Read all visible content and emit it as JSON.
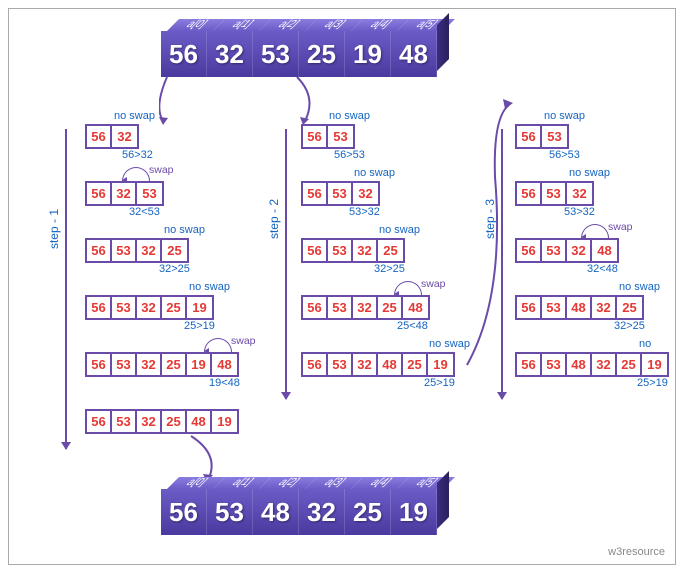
{
  "watermark": "w3resource",
  "top_array": {
    "indices": [
      "a[0]",
      "a[1]",
      "a[2]",
      "a[3]",
      "a[4]",
      "a[5]"
    ],
    "values": [
      "56",
      "32",
      "53",
      "25",
      "19",
      "48"
    ]
  },
  "bottom_array": {
    "indices": [
      "a[0]",
      "a[1]",
      "a[2]",
      "a[3]",
      "a[4]",
      "a[5]"
    ],
    "values": [
      "56",
      "53",
      "48",
      "32",
      "25",
      "19"
    ]
  },
  "labels": {
    "no_swap": "no swap",
    "swap": "swap"
  },
  "steps": {
    "s1": {
      "label": "step - 1",
      "rows": [
        {
          "cells": [
            "56",
            "32"
          ],
          "top": "no swap",
          "bottom": "56>32"
        },
        {
          "cells": [
            "56",
            "32",
            "53"
          ],
          "swap": true,
          "bottom": "32<53"
        },
        {
          "cells": [
            "56",
            "53",
            "32",
            "25"
          ],
          "top": "no swap",
          "bottom": "32>25"
        },
        {
          "cells": [
            "56",
            "53",
            "32",
            "25",
            "19"
          ],
          "top": "no swap",
          "bottom": "25>19"
        },
        {
          "cells": [
            "56",
            "53",
            "32",
            "25",
            "19",
            "48"
          ],
          "swap": true,
          "bottom": "19<48"
        },
        {
          "cells": [
            "56",
            "53",
            "32",
            "25",
            "48",
            "19"
          ]
        }
      ]
    },
    "s2": {
      "label": "step - 2",
      "rows": [
        {
          "cells": [
            "56",
            "53"
          ],
          "top": "no swap",
          "bottom": "56>53"
        },
        {
          "cells": [
            "56",
            "53",
            "32"
          ],
          "top": "no swap",
          "bottom": "53>32"
        },
        {
          "cells": [
            "56",
            "53",
            "32",
            "25"
          ],
          "top": "no swap",
          "bottom": "32>25"
        },
        {
          "cells": [
            "56",
            "53",
            "32",
            "25",
            "48"
          ],
          "swap": true,
          "bottom": "25<48"
        },
        {
          "cells": [
            "56",
            "53",
            "32",
            "48",
            "25",
            "19"
          ],
          "top": "no swap",
          "bottom": "25>19"
        }
      ]
    },
    "s3": {
      "label": "step - 3",
      "rows": [
        {
          "cells": [
            "56",
            "53"
          ],
          "top": "no swap",
          "bottom": "56>53"
        },
        {
          "cells": [
            "56",
            "53",
            "32"
          ],
          "top": "no swap",
          "bottom": "53>32"
        },
        {
          "cells": [
            "56",
            "53",
            "32",
            "48"
          ],
          "swap": true,
          "bottom": "32<48"
        },
        {
          "cells": [
            "56",
            "53",
            "48",
            "32",
            "25"
          ],
          "top": "no swap",
          "bottom": "32>25"
        },
        {
          "cells": [
            "56",
            "53",
            "48",
            "32",
            "25",
            "19"
          ],
          "top": "no swap",
          "bottom": "25>19"
        }
      ]
    }
  }
}
